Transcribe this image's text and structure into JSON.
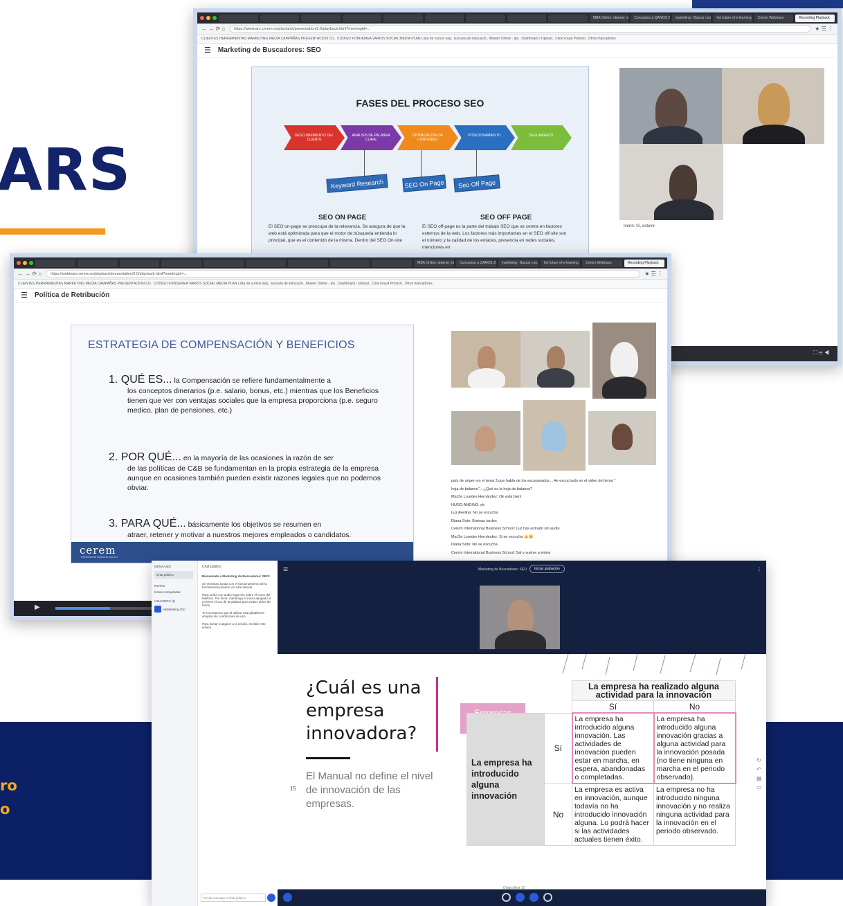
{
  "promo": {
    "heading": "ARS",
    "band_line1": "ro",
    "band_line2": "o"
  },
  "colors": {
    "navy": "#0c2065",
    "orange": "#f29a20",
    "chrome": "#2a2c31",
    "accent_blue": "#2c4f8c"
  },
  "window_seo": {
    "tabs": [
      "",
      "",
      "",
      "",
      "",
      "",
      "",
      "",
      "",
      "MBA Online: obtener mi m...",
      "Conceptos a QANOS 2021",
      "marketing - Buscar con...",
      "the future of e-learning",
      "Cerem Webinars",
      "Recording Playback"
    ],
    "url": "https://webinars.cerem.es/playback/presentation/2.0/playback.html?meetingId=...",
    "bookmarks": "CLIENTES  HERRAMIENTAS  MARKETING MEDIA  CAMPAÑAS  PRESENTACION CO..  CODIGO  FONDEMEA  VARIOS  SOCIAL MEDIA PLAN  Lista de cursos seg..  Escuela de Educació..  Master Online - Ips..  Dashboard / Upload..  Click Fraud Protecti..  Otros marcadores",
    "title": "Marketing de Buscadores: SEO",
    "slide": {
      "title": "FASES DEL PROCESO SEO",
      "chevrons": [
        "DESCUBRIMIENTO DEL CLIENTE",
        "ANÁLISIS DE PALABRA CLAVE",
        "OPTIMIZACIÓN DE CONTENIDO",
        "POSICIONAMIENTO",
        "SEGUIMIENTO"
      ],
      "keywords": [
        "Keyword Research",
        "SEO On Page",
        "Seo Off Page"
      ],
      "on_page_title": "SEO ON PAGE",
      "on_page_text": "El SEO on-page se preocupa de la relevancia. Se asegura de que la web está optimizada para que el motor de búsqueda entienda lo principal, que es el contenido de la misma. Dentro del SEO On-site",
      "off_page_title": "SEO OFF PAGE",
      "off_page_text": "El SEO off-page es la parte del trabajo SEO que se centra en factores externos de la web. Los factores más importantes en el SEO off-site son el número y la calidad de los enlaces, presencia en redes sociales, menciones en"
    },
    "chat_caption": "Ivonn: Sí, estuve"
  },
  "window_comp": {
    "tabs": [
      "",
      "",
      "",
      "",
      "",
      "",
      "",
      "",
      "",
      "MBA Online: obtener mi m...",
      "Conceptos a QANOS 2021",
      "marketing - Buscar con...",
      "the future of e-learning",
      "Cerem Webinars",
      "Recording Playback"
    ],
    "url": "https://webinars.cerem.es/playback/presentation/2.0/playback.html?meetingId=...",
    "bookmarks": "CLIENTES  HERRAMIENTAS  MARKETING MEDIA  CAMPAÑAS  PRESENTACION CO..  CODIGO  FONDEMEA  VARIOS  SOCIAL MEDIA PLAN  Lista de cursos seg..  Escuela de Educació..  Master Online - Ips..  Dashboard / Upload..  Click Fraud Protecti..  Otros marcadores",
    "title": "Política de Retribución",
    "slide": {
      "title": "ESTRATEGIA DE COMPENSACIÓN Y BENEFICIOS",
      "items": [
        {
          "head": "1.  QUÉ ES...",
          "lead": " la Compensación se refiere fundamentalmente a",
          "body": "los conceptos dinerarios (p.e. salario, bonus, etc.) mientras que los Beneficios tienen que ver con ventajas sociales que la empresa proporciona (p.e. seguro medico, plan de pensiones, etc.)"
        },
        {
          "head": "2.  POR QUÉ...",
          "lead": " en la mayoría de las ocasiones la razón de ser",
          "body": "de las políticas de C&B se fundamentan en la propia estrategia de la empresa aunque en ocasiones también pueden existir razones legales que no podemos obviar."
        },
        {
          "head": "3.  PARA QUÉ...",
          "lead": " básicamente los objetivos se resumen en",
          "body": "atraer, retener y motivar a nuestros mejores empleados o candidatos."
        }
      ],
      "logo": "cerem",
      "logo_sub": "International Business School"
    },
    "chat": [
      "país de origen en el tema 3 que habla de los escaparados....He escuchado en el video del tema \"",
      "hoja de balance\"....¿Qué es la hoja de balance?",
      "Ma.De Lourdes Hernández: Ok está bien!",
      "HUGO ANDINO: ok",
      "Luz Avelina: No se escucha",
      "Diana Soto: Buenas tardes",
      "Cerem International Business School: Luz has entrado sin audio",
      "Ma.De Lourdes Hernández: Si se escucha 👍😊",
      "Diana Soto: No se escucha",
      "Cerem International Business School: Sal y vuelve a entrar"
    ],
    "progress": 0.12
  },
  "window_meet": {
    "sidebar": {
      "section_messages": "MENSAJES",
      "public_chat": "Chat público",
      "section_notes": "NOTAS",
      "shared_notes": "Notas compartidas",
      "section_users": "USUARIOS (1)",
      "user": "eMarketing (Tú)",
      "chat_header": "Chat público",
      "welcome": "Bienvenido a Marketing de Buscadores: SEO!",
      "msg1": "Si necesitas ayuda con el funcionamiento de la herramienta puedes ver este tutorial.",
      "msg2": "Para unirte con audio haga clic sobre el icono del teléfono. Por favor, mantenga el micro apagado si no tiene el uso de la palabra para evitar ruidos de fondo.",
      "msg3": "Te recordamos que al utilizar esta plataforma aceptas las condiciones de uso.",
      "msg4": "Para invitar a alguien a la sesión, envíale este enlace.",
      "input_placeholder": "Enviar mensaje a Chat público"
    },
    "meeting_title": "Marketing de Buscadores: SEO",
    "recording_label": "Iniciar grabación",
    "slide": {
      "question": "¿Cuál es una empresa innovadora?",
      "manual": "El Manual no define el nivel de innovación de las empresas.",
      "page_num": "15",
      "tag": "Empresas innovadoras",
      "table_head": "La empresa ha realizado alguna actividad para la innovación",
      "col_si": "Sí",
      "col_no": "No",
      "row_label": "La empresa ha introducido alguna innovación",
      "row_si": "Sí",
      "row_no": "No",
      "c_si_si": "La empresa ha introducido alguna innovación. Las actividades de innovación pueden estar en marcha, en espera, abandonadas o completadas.",
      "c_si_no": "La empresa ha introducido alguna innovación gracias a alguna actividad para la innovación posada (no tiene ninguna en marcha en el periodo observado).",
      "c_no_si": "La empresa es activa en innovación, aunque todavía no ha introducido innovación alguna. Lo podrá hacer si las actividades actuales tienen éxito.",
      "c_no_no": "La empresa no ha introducido ninguna innovación y no realiza ninguna actividad para la innovación en el periodo observado."
    },
    "slide_nav": "Diapositiva 15"
  }
}
